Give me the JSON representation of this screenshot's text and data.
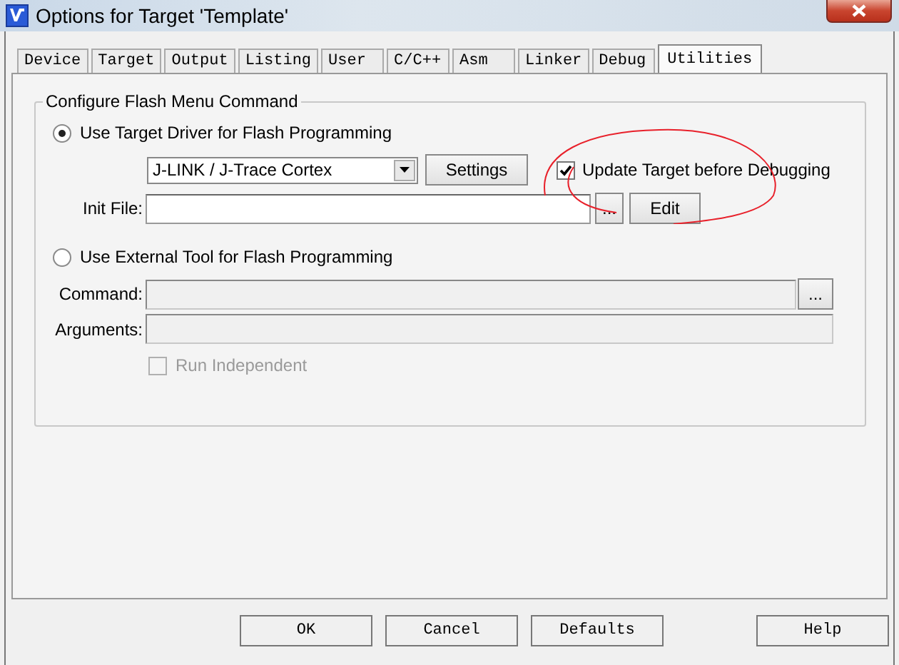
{
  "window": {
    "title": "Options for Target 'Template'"
  },
  "tabs": [
    {
      "label": "Device",
      "selected": false
    },
    {
      "label": "Target",
      "selected": false
    },
    {
      "label": "Output",
      "selected": false
    },
    {
      "label": "Listing",
      "selected": false
    },
    {
      "label": "User",
      "selected": false
    },
    {
      "label": "C/C++",
      "selected": false
    },
    {
      "label": "Asm",
      "selected": false
    },
    {
      "label": "Linker",
      "selected": false
    },
    {
      "label": "Debug",
      "selected": false
    },
    {
      "label": "Utilities",
      "selected": true
    }
  ],
  "group": {
    "title": "Configure Flash Menu Command"
  },
  "target_driver": {
    "label": "Use Target Driver for Flash Programming",
    "selected": true,
    "driver": "J-LINK / J-Trace Cortex",
    "settings_button": "Settings",
    "update_target": {
      "label": "Update Target before Debugging",
      "checked": true
    },
    "init_file": {
      "label": "Init File:",
      "browse_button": "...",
      "edit_button": "Edit"
    }
  },
  "external_tool": {
    "label": "Use External Tool for Flash Programming",
    "selected": false,
    "command": {
      "label": "Command:",
      "browse_button": "..."
    },
    "arguments": {
      "label": "Arguments:"
    },
    "run_independent": {
      "label": "Run Independent",
      "checked": false,
      "disabled": true
    }
  },
  "buttons": [
    "OK",
    "Cancel",
    "Defaults",
    "Help"
  ]
}
